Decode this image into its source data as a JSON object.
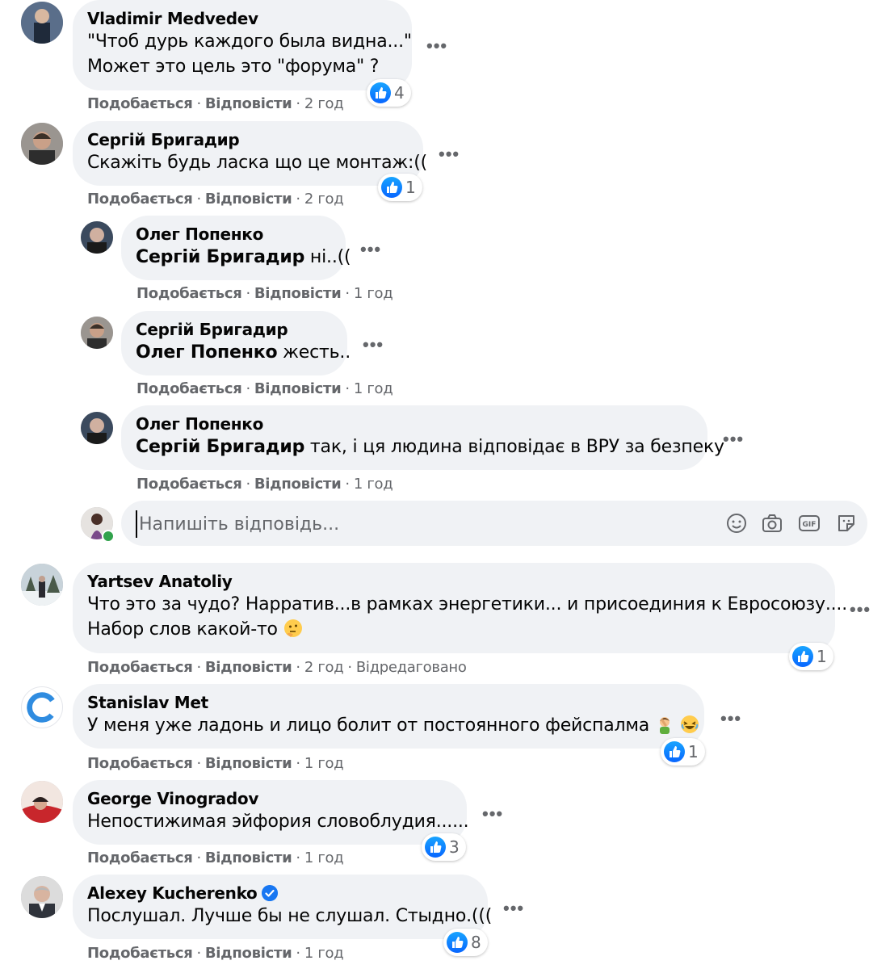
{
  "labels": {
    "like": "Подобається",
    "reply": "Відповісти",
    "dot": "·",
    "more": "•••"
  },
  "comments": [
    {
      "author": "Vladimir Medvedev",
      "lines": [
        "\"Чтоб дурь каждого была видна...\"",
        "Может это цель это \"форума\" ?"
      ],
      "time": "2 год",
      "reactions": "4"
    },
    {
      "author": "Сергій Бригадир",
      "lines": [
        "Скажіть будь ласка що це монтаж:(("
      ],
      "time": "2 год",
      "reactions": "1"
    },
    {
      "author": "Олег Попенко",
      "mention": "Сергій Бригадир",
      "text": " ні..((",
      "time": "1 год"
    },
    {
      "author": "Сергій Бригадир",
      "mention": "Олег Попенко",
      "text": " жесть..",
      "time": "1 год"
    },
    {
      "author": "Олег Попенко",
      "mention": "Сергій Бригадир",
      "text": " так, і ця людина відповідає в ВРУ за безпеку",
      "time": "1 год"
    },
    {
      "author": "Yartsev Anatoliy",
      "lines": [
        "Что это за чудо? Нарратив...в рамках энергетики... и присоединия к Евросоюзу....",
        "Набор слов какой-то"
      ],
      "time": "2 год",
      "edited": "Відредаговано",
      "reactions": "1"
    },
    {
      "author": "Stanislav Met",
      "lines": [
        "У меня уже ладонь и лицо болит от постоянного фейспалма"
      ],
      "time": "1 год",
      "reactions": "1"
    },
    {
      "author": "George Vinogradov",
      "lines": [
        "Непостижимая эйфория словоблудия......"
      ],
      "time": "1 год",
      "reactions": "3"
    },
    {
      "author": "Alexey Kucherenko",
      "lines": [
        "Послушал. Лучше бы не слушал. Стыдно.((("
      ],
      "time": "1 год",
      "reactions": "8",
      "verified": true
    }
  ],
  "reply_box": {
    "placeholder": "Напишіть відповідь..."
  },
  "icons": [
    "like-icon",
    "more-options-icon",
    "emoji-icon",
    "camera-icon",
    "gif-icon",
    "sticker-icon",
    "verified-badge-icon",
    "thinking-face-emoji",
    "facepalm-emoji",
    "laughing-face-emoji"
  ],
  "colors": {
    "bubble": "#f0f2f5",
    "like_blue": "#0866ff",
    "meta_gray": "#65676b",
    "online_green": "#31a24c",
    "verified_blue": "#1877f2"
  }
}
